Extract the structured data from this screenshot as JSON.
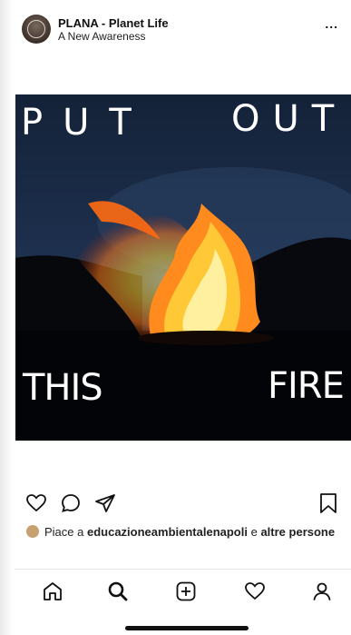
{
  "header": {
    "account_name": "PLANA - Planet Life",
    "subtitle": "A New Awareness",
    "more_label": "..."
  },
  "post": {
    "overlay": {
      "put": "PUT",
      "out": "OUT",
      "this": "THIS",
      "fire": "FIRE"
    }
  },
  "actions": {
    "icons": [
      "heart-icon",
      "comment-icon",
      "share-icon",
      "bookmark-icon"
    ]
  },
  "likes": {
    "prefix": "Piace a ",
    "user": "educazioneambientalenapoli",
    "middle": " e ",
    "suffix": "altre persone"
  },
  "navbar": {
    "icons": [
      "home-icon",
      "search-icon",
      "add-icon",
      "activity-icon",
      "profile-icon"
    ]
  },
  "colors": {
    "background": "#ffffff",
    "post_sky": "#0b1222",
    "flame": "#ff7a1a"
  }
}
